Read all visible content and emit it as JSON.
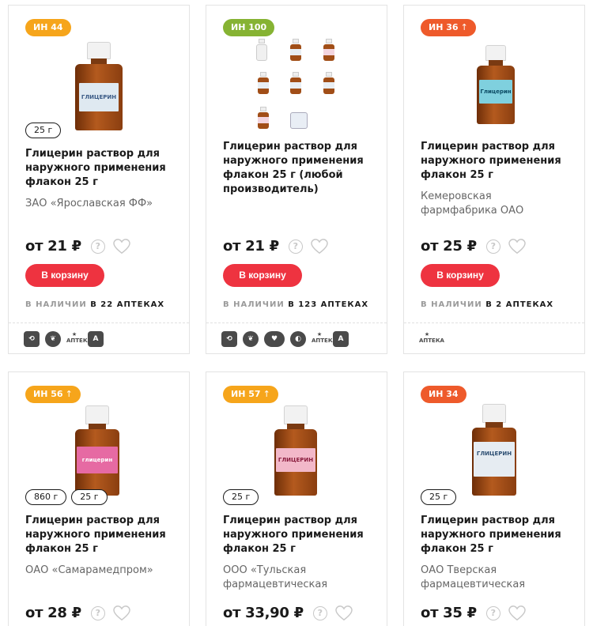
{
  "colors": {
    "badge_orange": "#f6a51b",
    "badge_green": "#86b333",
    "badge_red": "#ee5a2b",
    "cart": "#ee3340"
  },
  "products": [
    {
      "badge": "ИН 44",
      "badge_arrow": "",
      "badge_color": "#f6a51b",
      "sizes": [
        "25 г"
      ],
      "title": "Глицерин раствор для наружного применения флакон 25 г",
      "maker": "ЗАО «Ярославская ФФ»",
      "price": "от 21 ₽",
      "cart_label": "В корзину",
      "avail_prefix": "В НАЛИЧИИ",
      "avail_rest": "В 22 АПТЕКАХ",
      "pharmacy_logos": [
        "pharmacy-logo-1",
        "pharmacy-logo-2",
        "pharmacy-logo-3",
        "pharmacy-logo-4"
      ],
      "image_label": "ГЛИЦЕРИН"
    },
    {
      "badge": "ИН 100",
      "badge_arrow": "",
      "badge_color": "#86b333",
      "sizes": [],
      "title": "Глицерин раствор для наружного применения флакон 25 г (любой производитель)",
      "maker": "",
      "price": "от 21 ₽",
      "cart_label": "В корзину",
      "avail_prefix": "В НАЛИЧИИ",
      "avail_rest": "В 123 АПТЕКАХ",
      "pharmacy_logos": [
        "pharmacy-logo-1",
        "pharmacy-logo-2",
        "pharmacy-logo-5",
        "pharmacy-logo-6",
        "pharmacy-logo-3",
        "pharmacy-logo-4"
      ],
      "image_label": ""
    },
    {
      "badge": "ИН 36",
      "badge_arrow": "↑",
      "badge_color": "#ee5a2b",
      "sizes": [],
      "title": "Глицерин раствор для наружного применения флакон 25 г",
      "maker": "Кемеровская фармфабрика ОАО",
      "price": "от 25 ₽",
      "cart_label": "В корзину",
      "avail_prefix": "В НАЛИЧИИ",
      "avail_rest": "В 2 АПТЕКАХ",
      "pharmacy_logos": [
        "pharmacy-logo-3"
      ],
      "image_label": "Глицерин"
    },
    {
      "badge": "ИН 56",
      "badge_arrow": "↑",
      "badge_color": "#f6a51b",
      "sizes": [
        "860 г",
        "25 г"
      ],
      "title": "Глицерин раствор для наружного применения флакон 25 г",
      "maker": "ОАО «Самарамедпром»",
      "price": "от 28 ₽",
      "image_label": "глицерин"
    },
    {
      "badge": "ИН 57",
      "badge_arrow": "↑",
      "badge_color": "#f6a51b",
      "sizes": [
        "25 г"
      ],
      "title": "Глицерин раствор для наружного применения флакон 25 г",
      "maker": "ООО «Тульская фармацевтическая",
      "price": "от 33,90 ₽",
      "image_label": "ГЛИЦЕРИН"
    },
    {
      "badge": "ИН 34",
      "badge_arrow": "",
      "badge_color": "#ee5a2b",
      "sizes": [
        "25 г"
      ],
      "title": "Глицерин раствор для наружного применения флакон 25 г",
      "maker": "ОАО Тверская фармацевтическая",
      "price": "от 35 ₽",
      "image_label": "ГЛИЦЕРИН"
    }
  ]
}
